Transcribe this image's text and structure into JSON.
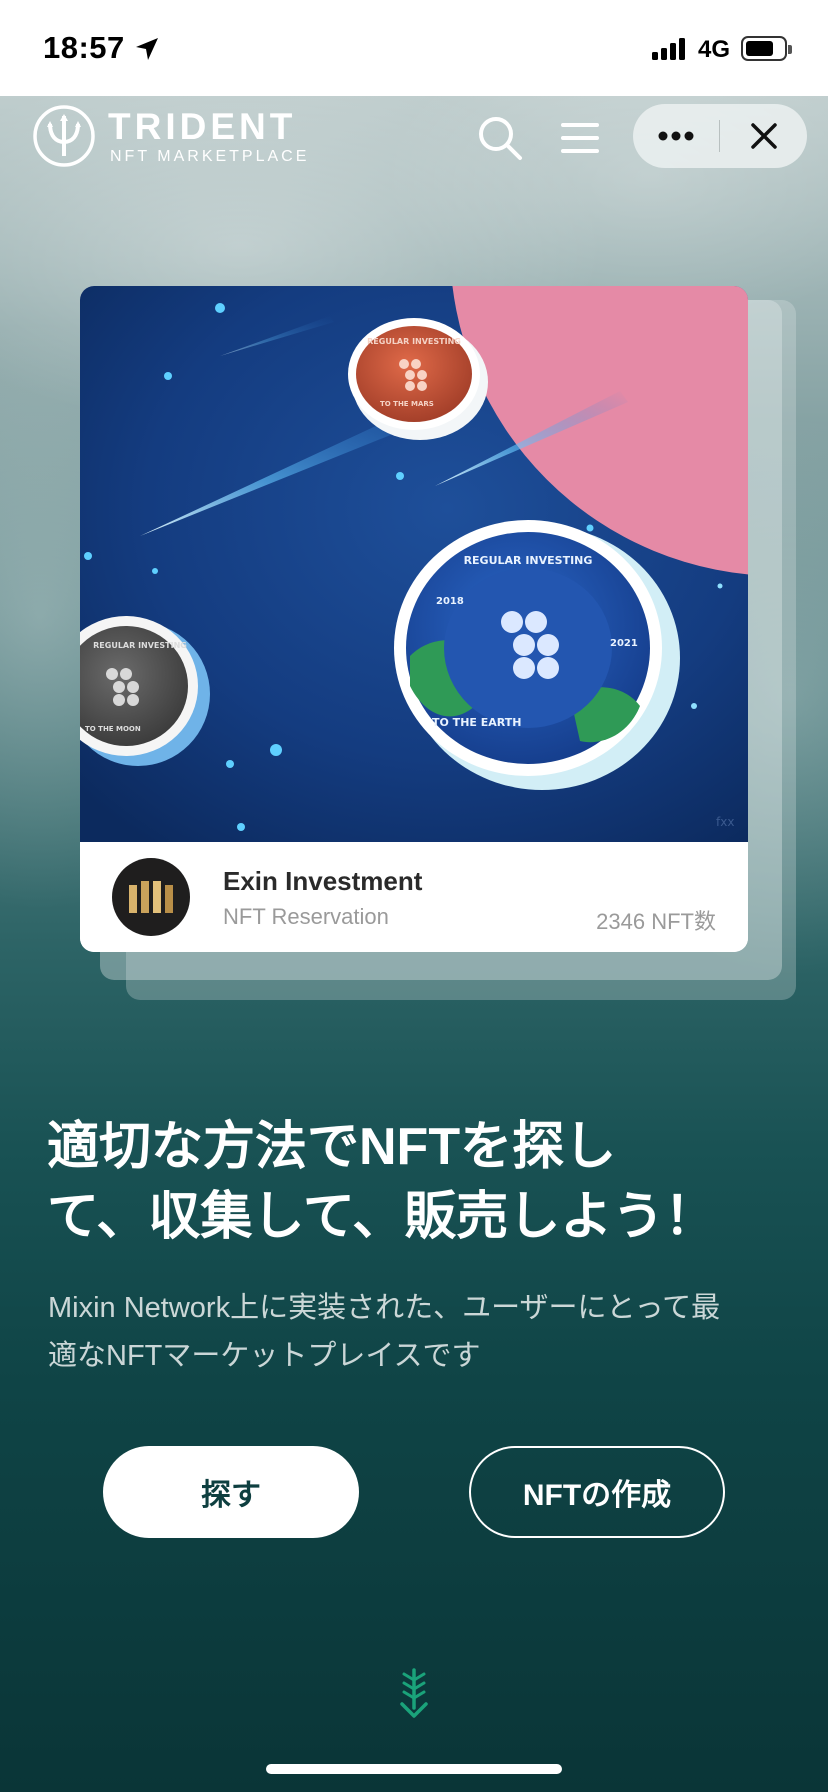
{
  "status_bar": {
    "time": "18:57",
    "network": "4G"
  },
  "brand": {
    "name": "TRIDENT",
    "subtitle": "NFT MARKETPLACE"
  },
  "header": {
    "search_icon": "search-icon",
    "menu_icon": "hamburger-menu-icon",
    "more_icon": "more-icon",
    "close_icon": "close-icon"
  },
  "featured_card": {
    "collection_name": "Exin Investment",
    "subtitle": "NFT Reservation",
    "count": "2346 NFT数",
    "art_text": {
      "big_coin_top": "REGULAR INVESTING",
      "big_coin_bottom": "TO THE EARTH",
      "year_left": "2018",
      "year_right": "2021",
      "gray_coin_top": "REGULAR INVESTING",
      "gray_coin_bottom": "TO THE MOON",
      "red_coin_top": "REGULAR INVESTING",
      "red_coin_bottom": "TO THE MARS",
      "watermark": "fxx"
    }
  },
  "hero": {
    "headline_line1": "適切な方法でNFTを探し",
    "headline_line2": "て、収集して、販売しよう！",
    "subtext_line1": "Mixin Network上に実装された、ユーザーにとって最",
    "subtext_line2": "適なNFTマーケットプレイスです"
  },
  "actions": {
    "explore_label": "探す",
    "create_label": "NFTの作成"
  },
  "colors": {
    "accent_teal": "#1aa37a",
    "button_text": "#0e3f40",
    "card_bg": "#163a7a"
  }
}
